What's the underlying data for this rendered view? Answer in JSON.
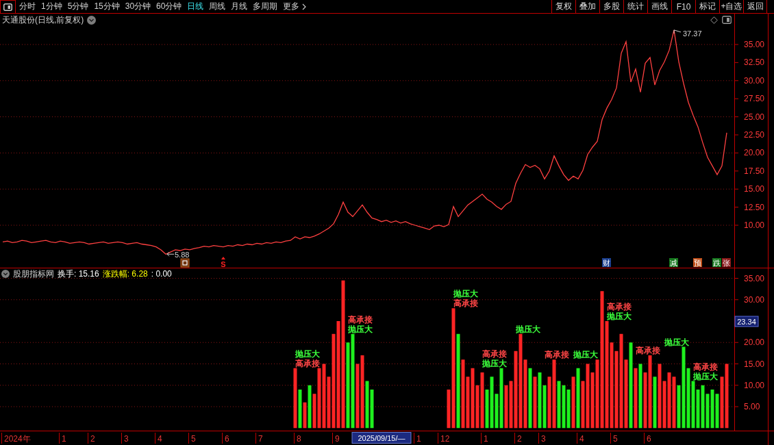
{
  "toolbar": {
    "periods": [
      {
        "label": "分时",
        "selected": false
      },
      {
        "label": "1分钟",
        "selected": false
      },
      {
        "label": "5分钟",
        "selected": false
      },
      {
        "label": "15分钟",
        "selected": false
      },
      {
        "label": "30分钟",
        "selected": false
      },
      {
        "label": "60分钟",
        "selected": false
      },
      {
        "label": "日线",
        "selected": true
      },
      {
        "label": "周线",
        "selected": false
      },
      {
        "label": "月线",
        "selected": false
      },
      {
        "label": "多周期",
        "selected": false
      }
    ],
    "more": "更多",
    "buttons": [
      "复权",
      "叠加",
      "多股",
      "统计",
      "画线",
      "F10",
      "标记",
      "+自选",
      "返回"
    ]
  },
  "price_chart": {
    "title": "天通股份(日线,前复权)",
    "chart_data": {
      "type": "line",
      "values": [
        7.7,
        7.8,
        7.6,
        7.7,
        7.9,
        7.8,
        7.6,
        7.7,
        7.8,
        7.9,
        7.7,
        7.6,
        7.8,
        7.7,
        7.5,
        7.6,
        7.7,
        7.6,
        7.4,
        7.5,
        7.6,
        7.7,
        7.5,
        7.6,
        7.7,
        7.6,
        7.4,
        7.5,
        7.6,
        7.4,
        7.3,
        7.2,
        7.0,
        6.6,
        6.0,
        6.3,
        6.6,
        6.5,
        6.7,
        6.6,
        6.8,
        6.9,
        7.1,
        7.0,
        7.2,
        7.1,
        7.0,
        7.2,
        7.1,
        7.3,
        7.2,
        7.4,
        7.3,
        7.5,
        7.4,
        7.6,
        7.5,
        7.7,
        7.6,
        7.8,
        7.9,
        8.4,
        8.1,
        8.4,
        8.3,
        8.5,
        8.8,
        9.2,
        9.6,
        10.2,
        11.5,
        13.2,
        11.8,
        11.2,
        12.0,
        12.8,
        11.8,
        11.0,
        10.8,
        10.5,
        10.7,
        10.4,
        10.6,
        10.3,
        10.5,
        10.2,
        10.0,
        9.8,
        9.6,
        9.4,
        9.9,
        10.0,
        9.8,
        10.1,
        12.6,
        11.2,
        12.0,
        12.8,
        13.3,
        13.8,
        14.3,
        13.6,
        13.2,
        12.6,
        12.2,
        12.9,
        13.3,
        15.8,
        17.2,
        18.4,
        18.0,
        18.3,
        17.8,
        16.4,
        17.5,
        19.6,
        18.2,
        17.0,
        16.2,
        16.8,
        16.4,
        17.6,
        19.8,
        20.8,
        21.6,
        24.6,
        26.2,
        27.4,
        29.0,
        33.8,
        35.4,
        29.8,
        31.6,
        28.4,
        32.4,
        33.2,
        29.4,
        31.4,
        32.6,
        34.2,
        37.0,
        32.6,
        29.6,
        27.0,
        25.2,
        23.6,
        21.4,
        19.4,
        18.2,
        17.0,
        18.2,
        22.8
      ],
      "ylim": [
        4.13,
        39.26
      ],
      "yticks": [
        {
          "value": 35,
          "label": "35.00"
        },
        {
          "value": 32.5,
          "label": "32.50"
        },
        {
          "value": 30,
          "label": "30.00"
        },
        {
          "value": 27.5,
          "label": "27.50"
        },
        {
          "value": 25,
          "label": "25.00"
        },
        {
          "value": 22.5,
          "label": "22.50"
        },
        {
          "value": 20,
          "label": "20.00"
        },
        {
          "value": 17.5,
          "label": "17.50"
        },
        {
          "value": 15,
          "label": "15.00"
        },
        {
          "value": 12.5,
          "label": "12.50"
        },
        {
          "value": 10,
          "label": "10.00"
        }
      ],
      "grid": true,
      "annotations": [
        "37.37",
        "5.88"
      ]
    },
    "markers": [
      {
        "kind": "square"
      },
      {
        "kind": "signal",
        "text": "S"
      },
      {
        "kind": "badge",
        "text": "财",
        "color": "#1b3f8f"
      },
      {
        "kind": "badge",
        "text": "减",
        "color": "#16781e"
      },
      {
        "kind": "badge",
        "text": "预",
        "color": "#c2501a"
      },
      {
        "kind": "badge",
        "text": "跌",
        "color": "#16781e"
      },
      {
        "kind": "badge",
        "text": "张",
        "color": "#8c1a1a"
      }
    ]
  },
  "indicator": {
    "title": "股朋指标网",
    "readouts": [
      {
        "text": "换手: 15.16",
        "color": "#ffffff"
      },
      {
        "text": "涨跌幅: 6.28",
        "color": "#ffff00"
      },
      {
        "text": ": 0.00",
        "color": "#ffffff"
      }
    ],
    "chart_data": {
      "type": "bar",
      "values": [
        0,
        0,
        0,
        0,
        0,
        0,
        0,
        0,
        0,
        0,
        0,
        0,
        0,
        0,
        0,
        0,
        0,
        0,
        0,
        0,
        0,
        0,
        0,
        0,
        0,
        0,
        0,
        0,
        0,
        0,
        0,
        0,
        0,
        0,
        0,
        0,
        0,
        0,
        0,
        0,
        0,
        0,
        0,
        0,
        0,
        0,
        0,
        0,
        0,
        0,
        0,
        0,
        0,
        0,
        0,
        0,
        0,
        0,
        0,
        0,
        0,
        14,
        9,
        6,
        10,
        8,
        14,
        15,
        12,
        22,
        25,
        34.5,
        20,
        22,
        15,
        17,
        11,
        9,
        0,
        0,
        0,
        0,
        0,
        0,
        0,
        0,
        0,
        0,
        0,
        0,
        0,
        0,
        0,
        9,
        28,
        22,
        16,
        12,
        14,
        10,
        13,
        9,
        12,
        8,
        14,
        10,
        11,
        18,
        22,
        16,
        14,
        12,
        13,
        10,
        12,
        16,
        11,
        10,
        9,
        12,
        14,
        11,
        15,
        13,
        16,
        32,
        25,
        20,
        18,
        22,
        16,
        20,
        14,
        15,
        13,
        17,
        12,
        15,
        11,
        13,
        12,
        10,
        19,
        14,
        11,
        9,
        10,
        8,
        9,
        8,
        12,
        15
      ],
      "ylim": [
        -0.6,
        37.32
      ],
      "yticks": [
        {
          "value": 35,
          "label": "35.00"
        },
        {
          "value": 30,
          "label": "30.00"
        },
        {
          "value": 20,
          "label": "20.00"
        },
        {
          "value": 15,
          "label": "15.00"
        },
        {
          "value": 10,
          "label": "10.00"
        },
        {
          "value": 5,
          "label": "5.00"
        }
      ],
      "grid": true
    },
    "signals": [
      {
        "text": "高承接",
        "color": "#ff4646"
      },
      {
        "text": "抛压大",
        "color": "#3cff3c"
      },
      {
        "text": "抛压大",
        "color": "#3cff3c"
      },
      {
        "text": "高承接",
        "color": "#ff4646"
      },
      {
        "text": "高承接",
        "color": "#ff4646"
      },
      {
        "text": "抛压大",
        "color": "#3cff3c"
      },
      {
        "text": "抛压大",
        "color": "#3cff3c"
      },
      {
        "text": "高承接",
        "color": "#ff4646"
      },
      {
        "text": "抛压大",
        "color": "#3cff3c"
      },
      {
        "text": "高承接",
        "color": "#ff4646"
      },
      {
        "text": "抛压大",
        "color": "#3cff3c"
      },
      {
        "text": "抛压大",
        "color": "#3cff3c"
      },
      {
        "text": "高承接",
        "color": "#ff4646"
      },
      {
        "text": "高承接",
        "color": "#ff4646"
      },
      {
        "text": "抛压大",
        "color": "#3cff3c"
      },
      {
        "text": "抛压大",
        "color": "#3cff3c"
      },
      {
        "text": "高承接",
        "color": "#ff4646"
      }
    ],
    "cursor_value": "23.34"
  },
  "time_axis": {
    "labels": [
      "2024年",
      "1",
      "2",
      "3",
      "4",
      "5",
      "6",
      "7",
      "8",
      "9",
      "1",
      "12",
      "1",
      "2",
      "3",
      "4",
      "5",
      "6"
    ],
    "cursor_date": "2025/09/15/—"
  }
}
